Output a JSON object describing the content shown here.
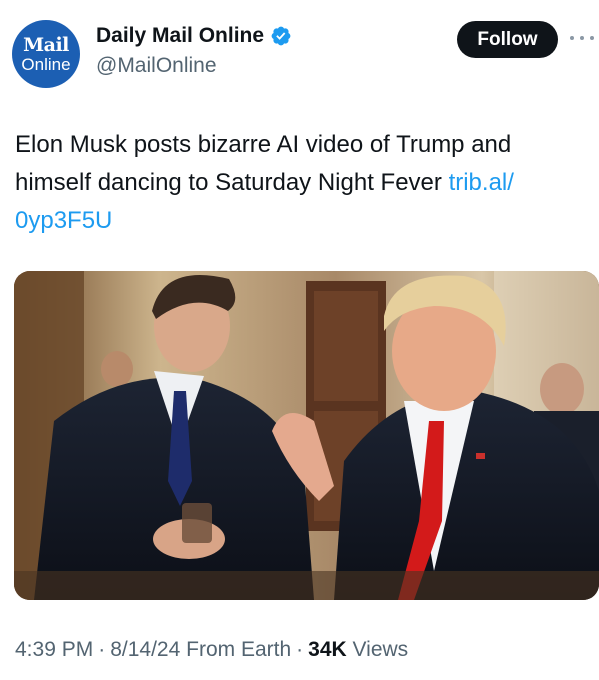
{
  "author": {
    "avatar_line1": "Mail",
    "avatar_line2": "Online",
    "display_name": "Daily Mail Online",
    "handle": "@MailOnline",
    "verified": true
  },
  "actions": {
    "follow_label": "Follow",
    "more_icon": "more-horizontal-icon"
  },
  "tweet": {
    "text": "Elon Musk posts bizarre AI video of Trump and himself dancing to Saturday Night Fever",
    "link_text": "trib.al/\n0yp3F5U"
  },
  "meta": {
    "time": "4:39 PM",
    "date": "8/14/24",
    "source": "From Earth",
    "views_count": "34K",
    "views_label": "Views"
  },
  "colors": {
    "link": "#1d9bf0",
    "follow_bg": "#0f1419",
    "avatar_bg": "#1c5fb3",
    "verified": "#1d9bf0",
    "muted_text": "#536471"
  }
}
